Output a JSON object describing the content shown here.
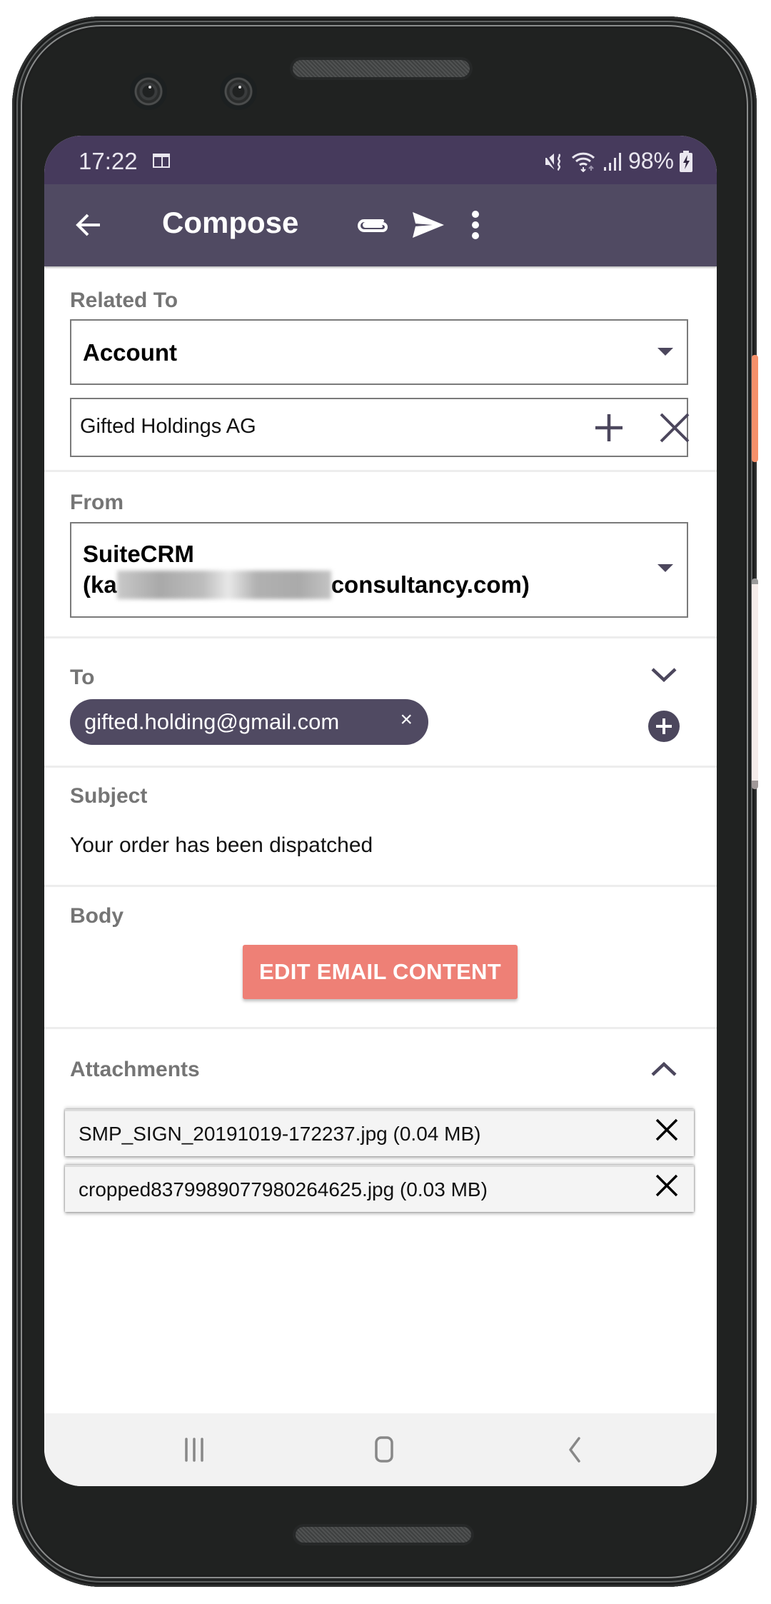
{
  "status_bar": {
    "time": "17:22",
    "battery": "98%",
    "icons": [
      "calendar-notification-icon",
      "mute-vibrate-icon",
      "wifi-icon",
      "signal-icon",
      "battery-charging-icon"
    ]
  },
  "toolbar": {
    "title": "Compose",
    "back_icon": "arrow-back-icon",
    "attach_icon": "paperclip-icon",
    "send_icon": "send-icon",
    "more_icon": "more-vert-icon"
  },
  "related_to": {
    "label": "Related To",
    "type_value": "Account",
    "record_value": "Gifted Holdings AG"
  },
  "from": {
    "label": "From",
    "line1": "SuiteCRM",
    "line2_prefix": "(ka",
    "line2_suffix": "consultancy.com)"
  },
  "to": {
    "label": "To",
    "recipients": [
      {
        "email": "gifted.holding@gmail.com",
        "remove_glyph": "×"
      }
    ]
  },
  "subject": {
    "label": "Subject",
    "value": "Your order has been dispatched"
  },
  "body": {
    "label": "Body",
    "edit_button": "EDIT EMAIL CONTENT"
  },
  "attachments": {
    "label": "Attachments",
    "items": [
      {
        "name": "SMP_SIGN_20191019-172237.jpg (0.04 MB)"
      },
      {
        "name": "cropped8379989077980264625.jpg (0.03 MB)"
      }
    ]
  },
  "colors": {
    "status_bar": "#463a5c",
    "toolbar": "#504a62",
    "accent_button": "#ee8076",
    "chip": "#504a62",
    "label_gray": "#757575"
  }
}
